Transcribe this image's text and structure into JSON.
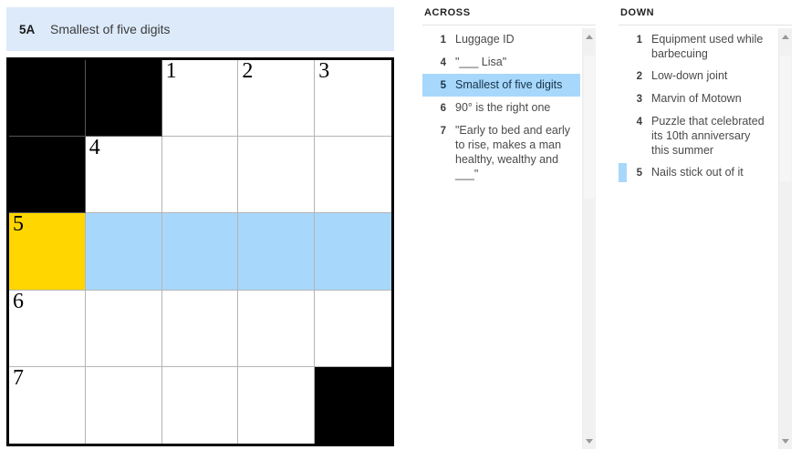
{
  "banner": {
    "number": "5A",
    "text": "Smallest of five digits"
  },
  "colors": {
    "banner_bg": "#dceafa",
    "cursor_cell": "#ffd600",
    "highlight": "#a7d8fb",
    "block": "#000000"
  },
  "grid": {
    "rows": 5,
    "cols": 5,
    "cells": [
      [
        {
          "type": "block",
          "num": "",
          "letter": ""
        },
        {
          "type": "block",
          "num": "",
          "letter": ""
        },
        {
          "type": "open",
          "num": "1",
          "letter": ""
        },
        {
          "type": "open",
          "num": "2",
          "letter": ""
        },
        {
          "type": "open",
          "num": "3",
          "letter": ""
        }
      ],
      [
        {
          "type": "block",
          "num": "",
          "letter": ""
        },
        {
          "type": "open",
          "num": "4",
          "letter": ""
        },
        {
          "type": "open",
          "num": "",
          "letter": ""
        },
        {
          "type": "open",
          "num": "",
          "letter": ""
        },
        {
          "type": "open",
          "num": "",
          "letter": ""
        }
      ],
      [
        {
          "type": "cursor",
          "num": "5",
          "letter": ""
        },
        {
          "type": "highlight",
          "num": "",
          "letter": ""
        },
        {
          "type": "highlight",
          "num": "",
          "letter": ""
        },
        {
          "type": "highlight",
          "num": "",
          "letter": ""
        },
        {
          "type": "highlight",
          "num": "",
          "letter": ""
        }
      ],
      [
        {
          "type": "open",
          "num": "6",
          "letter": ""
        },
        {
          "type": "open",
          "num": "",
          "letter": ""
        },
        {
          "type": "open",
          "num": "",
          "letter": ""
        },
        {
          "type": "open",
          "num": "",
          "letter": ""
        },
        {
          "type": "open",
          "num": "",
          "letter": ""
        }
      ],
      [
        {
          "type": "open",
          "num": "7",
          "letter": ""
        },
        {
          "type": "open",
          "num": "",
          "letter": ""
        },
        {
          "type": "open",
          "num": "",
          "letter": ""
        },
        {
          "type": "open",
          "num": "",
          "letter": ""
        },
        {
          "type": "block",
          "num": "",
          "letter": ""
        }
      ]
    ]
  },
  "across": {
    "heading": "ACROSS",
    "clues": [
      {
        "num": "1",
        "text": "Luggage ID",
        "selected": false,
        "crossmark": false
      },
      {
        "num": "4",
        "text": "\"___ Lisa\"",
        "selected": false,
        "crossmark": false
      },
      {
        "num": "5",
        "text": "Smallest of five digits",
        "selected": true,
        "crossmark": false
      },
      {
        "num": "6",
        "text": "90° is the right one",
        "selected": false,
        "crossmark": false
      },
      {
        "num": "7",
        "text": "\"Early to bed and early to rise, makes a man healthy, wealthy and ___\"",
        "selected": false,
        "crossmark": false
      }
    ]
  },
  "down": {
    "heading": "DOWN",
    "clues": [
      {
        "num": "1",
        "text": "Equipment used while barbecuing",
        "selected": false,
        "crossmark": false
      },
      {
        "num": "2",
        "text": "Low-down joint",
        "selected": false,
        "crossmark": false
      },
      {
        "num": "3",
        "text": "Marvin of Motown",
        "selected": false,
        "crossmark": false
      },
      {
        "num": "4",
        "text": "Puzzle that celebrated its 10th anniversary this summer",
        "selected": false,
        "crossmark": false
      },
      {
        "num": "5",
        "text": "Nails stick out of it",
        "selected": false,
        "crossmark": true
      }
    ]
  },
  "scrollbars": {
    "across": {
      "up_icon": "caret-up-icon",
      "down_icon": "caret-down-icon",
      "thumb_top_pct": 3,
      "thumb_height_pct": 34
    },
    "down": {
      "up_icon": "caret-up-icon",
      "down_icon": "caret-down-icon",
      "thumb_top_pct": 3,
      "thumb_height_pct": 30
    }
  }
}
